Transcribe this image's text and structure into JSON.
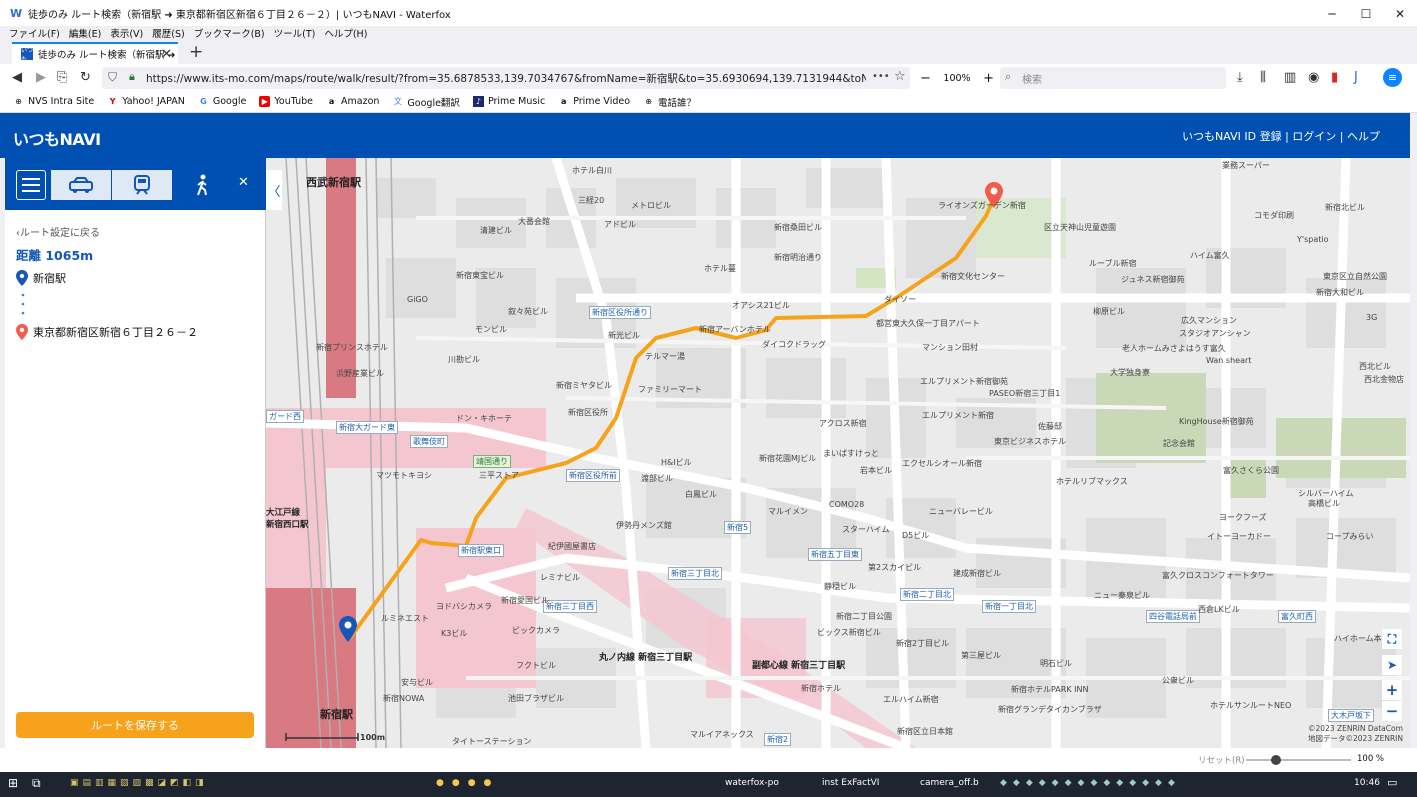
{
  "window": {
    "title": "徒歩のみ ルート検索（新宿駅 ➜ 東京都新宿区新宿６丁目２６－２）| いつもNAVI - Waterfox",
    "controls": [
      "─",
      "☐",
      "✕"
    ]
  },
  "menu": [
    "ファイル(F)",
    "編集(E)",
    "表示(V)",
    "履歴(S)",
    "ブックマーク(B)",
    "ツール(T)",
    "ヘルプ(H)"
  ],
  "tab": {
    "favicon_text": "いつも",
    "label": "徒歩のみ ルート検索（新宿駅 ➜",
    "close": "✕",
    "new": "+"
  },
  "nav": {
    "url": "https://www.its-mo.com/maps/route/walk/result/?from=35.6878533,139.7034767&fromName=新宿駅&to=35.6930694,139.7131944&toName=東京都新宿区新",
    "more": "•••",
    "zoom_minus": "−",
    "zoom": "100%",
    "zoom_plus": "+",
    "search_placeholder": "検索"
  },
  "bookmarks": [
    "NVS Intra Site",
    "Yahoo! JAPAN",
    "Google",
    "YouTube",
    "Amazon",
    "Google翻訳",
    "Prime Music",
    "Prime Video",
    "電話誰？"
  ],
  "site": {
    "logo": "いつもNAVI",
    "header_links": "いつもNAVI ID 登録 |  ログイン |  ヘルプ"
  },
  "sidebar": {
    "back": "ルート設定に戻る",
    "distance": "距離 1065m",
    "start": "新宿駅",
    "goal": "東京都新宿区新宿６丁目２６－２",
    "save_button": "ルートを保存する",
    "close": "✕"
  },
  "map": {
    "collapse": "〈",
    "scale": "100m",
    "copyright1": "©2023 ZENRIN DataCom",
    "copyright2": "地図データ©2023 ZENRIN",
    "stations": [
      "西武新宿駅",
      "丸ノ内線 新宿三丁目駅",
      "副都心線 新宿三丁目駅",
      "新宿駅",
      "大江戸線 新宿西口駅"
    ],
    "roads": [
      "新宿区役所通り",
      "新宿大ガード東",
      "歌舞伎町",
      "靖国通り",
      "新宿区役所前",
      "新宿駅東口",
      "新宿三丁目北",
      "新宿五丁目東",
      "新宿5",
      "新宿三丁目西",
      "新宿二丁目北",
      "新宿一丁目北",
      "四谷電話局前",
      "富久町西",
      "大木戸坂下",
      "新宿2",
      "ガード西"
    ],
    "labels": [
      "ホテル白川",
      "三経20",
      "メトロビル",
      "大番会館",
      "清建ビル",
      "アドビル",
      "ホテル蔓",
      "新宿東宝ビル",
      "GiGO",
      "叙々苑ビル",
      "モンビル",
      "川勘ビル",
      "新宿プリンスホテル",
      "浜野産業ビル",
      "ドン・キホーテ",
      "マツモトキヨシ",
      "三平ストア",
      "新宿ミヤタビル",
      "新宿区役所",
      "ファミリーマート",
      "テルマー湯",
      "新光ビル",
      "新宿アーバンホテル",
      "オアシス21ビル",
      "ダイコクドラッグ",
      "ダイソー",
      "新宿文化センター",
      "ライオンズガーデン新宿",
      "新宿明治通り",
      "新宿桑田ビル",
      "都営東大久保一丁目アパート",
      "マンション田村",
      "エルプリメント新宿御苑",
      "PASEO新宿三丁目1",
      "エルプリメント新宿",
      "東京ビジネスホテル",
      "アクロス新宿",
      "新宿花園MJビル",
      "まいばすけっと",
      "岩本ビル",
      "エクセルシオール新宿",
      "H&Iビル",
      "渡部ビル",
      "白鳳ビル",
      "マルイメン",
      "COMO28",
      "スターハイム",
      "ニューバレービル",
      "D5ビル",
      "伊勢丹メンズ館",
      "紀伊國屋書店",
      "レミナビル",
      "新宿愛国ビル",
      "ヨドバシカメラ",
      "ビックカメラ",
      "ルミネエスト",
      "K3ビル",
      "フクトビル",
      "池田ブラザビル",
      "新宿NOWA",
      "安与ビル",
      "タイトーステーション",
      "マルイアネックス",
      "新宿区立日本館",
      "ビックス新宿ビル",
      "新宿ホテル",
      "第2スカイビル",
      "建成新宿ビル",
      "新宿二丁目公園",
      "静穏ビル",
      "新宿ホテルPARK INN",
      "エルハイム新宿",
      "新宿グランデタイカンブラザ",
      "明石ビル",
      "公衆ビル",
      "新宿2丁目ビル",
      "第三屋ビル",
      "ホテルサンルートNEO",
      "大学独身寮",
      "記念会館",
      "富久さくら公園",
      "KingHouse新宿御苑",
      "佐藤邸",
      "ヨークフーズ",
      "イトーヨーカドー",
      "ホテルリブマックス",
      "シルバーハイム",
      "富久クロスコンフォートタワー",
      "ニュー秦泉ビル",
      "西倉LKビル",
      "ハイホーム本陣",
      "区立天神山児童遊園",
      "ルーブル新宿",
      "ジュネス新宿御苑",
      "柳原ビル",
      "広久マンション",
      "スタジオアンシャン",
      "老人ホームみさよはうす富久",
      "業務スーパー",
      "コモダ印刷",
      "ハイム富久",
      "東京区立自然公園",
      "高橋ビル",
      "コープみらい",
      "新宿北ビル",
      "新宿大和ビル",
      "西北ビル",
      "西北金物店",
      "Wan sheart",
      "Y'spatio",
      "3G"
    ]
  },
  "statusbar": {
    "reset": "リセット(R)",
    "zoom": "100 %"
  },
  "taskbar": {
    "items": [
      "waterfox-po",
      "inst ExFactVI",
      "camera_off.b"
    ],
    "time": "10:46"
  }
}
